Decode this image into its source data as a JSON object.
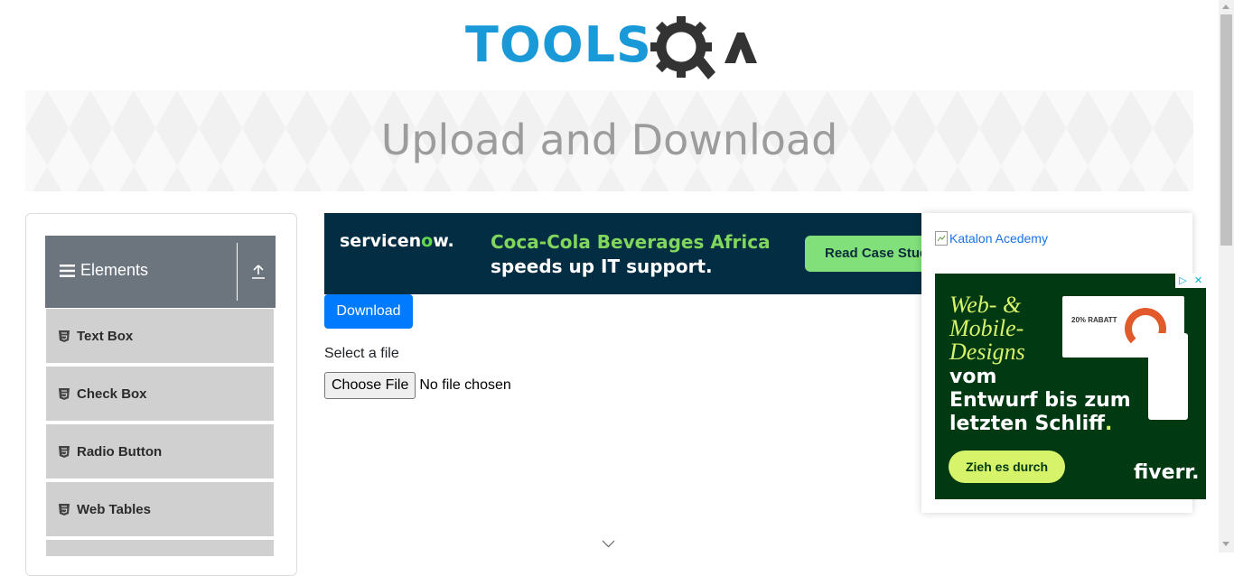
{
  "logo": {
    "text": "TOOLS",
    "suffix": "QA"
  },
  "banner": {
    "title": "Upload and Download"
  },
  "sidebar": {
    "group_title": "Elements",
    "items": [
      {
        "label": "Text Box"
      },
      {
        "label": "Check Box"
      },
      {
        "label": "Radio Button"
      },
      {
        "label": "Web Tables"
      }
    ]
  },
  "top_ad": {
    "brand_prefix": "servicen",
    "brand_o": "o",
    "brand_suffix": "w.",
    "line1": "Coca-Cola Beverages Africa",
    "line2": "speeds up IT support.",
    "cta": "Read Case Study"
  },
  "main": {
    "download_label": "Download",
    "select_label": "Select a file",
    "choose_file_label": "Choose File",
    "file_status": "No file chosen"
  },
  "right_ad": {
    "katalon_alt": "Katalon Acedemy",
    "fiverr": {
      "line1": "Web- &",
      "line2": "Mobile-",
      "line3": "Designs",
      "line4": "vom",
      "line5": "Entwurf bis zum",
      "line6": "letzten Schliff",
      "line6_end": ".",
      "cta": "Zieh es durch",
      "brand": "fiverr.",
      "mock_text": "20% RABATT"
    }
  },
  "colors": {
    "logo_blue": "#1a99d8",
    "logo_dark": "#333333",
    "primary": "#007bff",
    "sidebar_header": "#6c757d",
    "sidebar_item": "#d0d0d0",
    "servicenow_bg": "#032d42",
    "servicenow_green": "#81d65d",
    "fiverr_bg": "#003912",
    "fiverr_lime": "#d7f36a"
  },
  "icons": [
    "gear-magnifier-icon",
    "hamburger-icon",
    "collapse-up-icon",
    "html5-icon",
    "broken-image-icon",
    "adchoices-icon",
    "close-icon",
    "chevron-down-icon"
  ]
}
